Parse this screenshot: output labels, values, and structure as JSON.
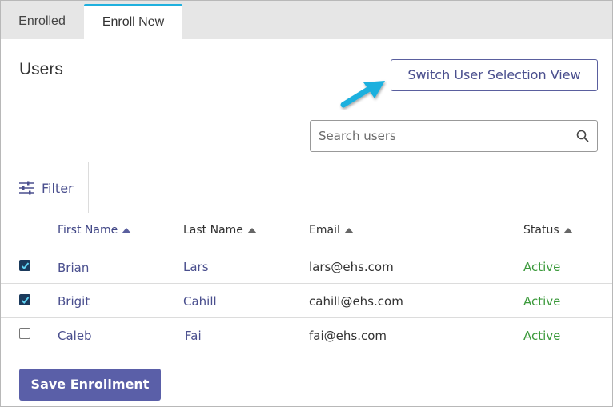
{
  "tabs": [
    {
      "label": "Enrolled",
      "active": false
    },
    {
      "label": "Enroll New",
      "active": true
    }
  ],
  "page_title": "Users",
  "switch_view_label": "Switch User Selection View",
  "search": {
    "placeholder": "Search users",
    "value": ""
  },
  "filter_label": "Filter",
  "table": {
    "columns": [
      "First Name",
      "Last Name",
      "Email",
      "Status"
    ],
    "rows": [
      {
        "checked": true,
        "first_name": "Brian",
        "last_name": "Lars",
        "email": "lars@ehs.com",
        "status": "Active"
      },
      {
        "checked": true,
        "first_name": "Brigit",
        "last_name": "Cahill",
        "email": "cahill@ehs.com",
        "status": "Active"
      },
      {
        "checked": false,
        "first_name": "Caleb",
        "last_name": "Fai",
        "email": "fai@ehs.com",
        "status": "Active"
      }
    ]
  },
  "save_label": "Save Enrollment",
  "colors": {
    "accent": "#5a5fa8",
    "tab_indicator": "#1fb0de",
    "link": "#4a4f8e",
    "status_active": "#3c9a3c",
    "checkbox_checked": "#1b3a5c",
    "arrow": "#1fb0de"
  },
  "icons": {
    "search": "search-icon",
    "filter": "filter-sliders-icon",
    "callout": "callout-arrow-icon"
  }
}
